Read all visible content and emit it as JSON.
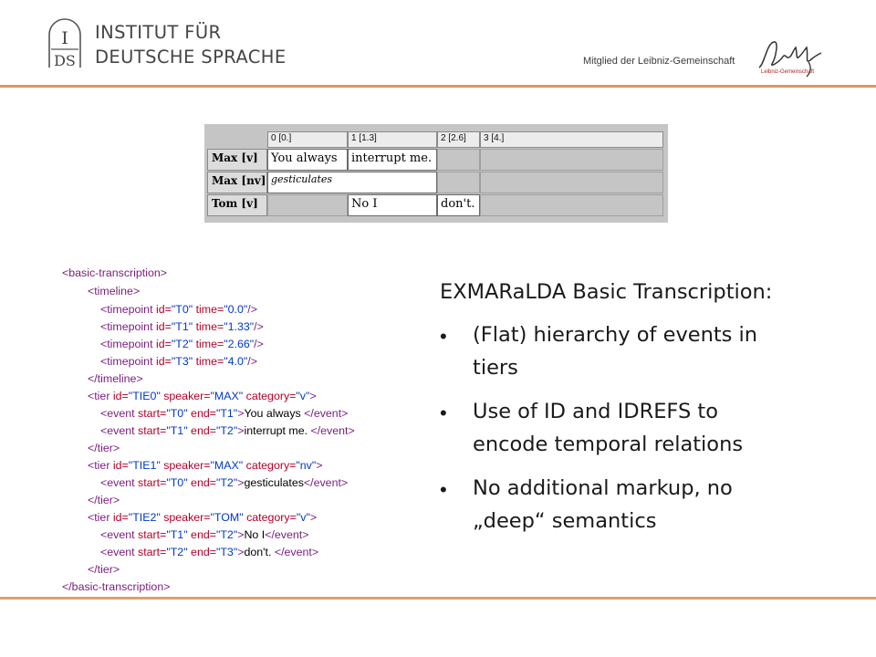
{
  "header": {
    "institute_line1": "INSTITUT FÜR",
    "institute_line2": "DEUTSCHE SPRACHE",
    "member_text": "Mitglied der Leibniz-Gemeinschaft",
    "logo_left": "IDS-logo",
    "logo_right": "Leibniz-Gemeinschaft-logo"
  },
  "score": {
    "columns": [
      "0 [0.]",
      "1 [1.3]",
      "2 [2.6]",
      "3 [4.]"
    ],
    "rows": [
      {
        "label": "Max [v]",
        "events": [
          "You always",
          "interrupt me."
        ]
      },
      {
        "label": "Max [nv]",
        "events": [
          "gesticulates"
        ]
      },
      {
        "label": "Tom [v]",
        "events": [
          "No I",
          "don't."
        ]
      }
    ]
  },
  "xml": {
    "l1": "<basic-transcription>",
    "l2": "<timeline>",
    "l3": {
      "open": "<timepoint ",
      "a1": "id=",
      "v1": "\"T0\"",
      "a2": " time=",
      "v2": "\"0.0\"",
      "close": "/>"
    },
    "l4": {
      "open": "<timepoint ",
      "a1": "id=",
      "v1": "\"T1\"",
      "a2": " time=",
      "v2": "\"1.33\"",
      "close": "/>"
    },
    "l5": {
      "open": "<timepoint ",
      "a1": "id=",
      "v1": "\"T2\"",
      "a2": " time=",
      "v2": "\"2.66\"",
      "close": "/>"
    },
    "l6": {
      "open": "<timepoint ",
      "a1": "id=",
      "v1": "\"T3\"",
      "a2": " time=",
      "v2": "\"4.0\"",
      "close": "/>"
    },
    "l7": "</timeline>",
    "l8": {
      "open": "<tier ",
      "a1": "id=",
      "v1": "\"TIE0\"",
      "a2": " speaker=",
      "v2": "\"MAX\"",
      "a3": " category=",
      "v3": "\"v\"",
      "close": ">"
    },
    "l9": {
      "open": "<event ",
      "a1": "start=",
      "v1": "\"T0\"",
      "a2": " end=",
      "v2": "\"T1\"",
      "mid": ">",
      "text": "You always ",
      "close": "</event>"
    },
    "l10": {
      "open": "<event ",
      "a1": "start=",
      "v1": "\"T1\"",
      "a2": " end=",
      "v2": "\"T2\"",
      "mid": ">",
      "text": "interrupt me. ",
      "close": "</event>"
    },
    "l11": "</tier>",
    "l12": {
      "open": "<tier ",
      "a1": "id=",
      "v1": "\"TIE1\"",
      "a2": " speaker=",
      "v2": "\"MAX\"",
      "a3": " category=",
      "v3": "\"nv\"",
      "close": ">"
    },
    "l13": {
      "open": "<event ",
      "a1": "start=",
      "v1": "\"T0\"",
      "a2": " end=",
      "v2": "\"T2\"",
      "mid": ">",
      "text": "gesticulates",
      "close": "</event>"
    },
    "l14": "</tier>",
    "l15": {
      "open": "<tier ",
      "a1": "id=",
      "v1": "\"TIE2\"",
      "a2": " speaker=",
      "v2": "\"TOM\"",
      "a3": " category=",
      "v3": "\"v\"",
      "close": ">"
    },
    "l16": {
      "open": "<event ",
      "a1": "start=",
      "v1": "\"T1\"",
      "a2": " end=",
      "v2": "\"T2\"",
      "mid": ">",
      "text": "No I",
      "close": "</event>"
    },
    "l17": {
      "open": "<event ",
      "a1": "start=",
      "v1": "\"T2\"",
      "a2": " end=",
      "v2": "\"T3\"",
      "mid": ">",
      "text": "don't. ",
      "close": "</event>"
    },
    "l18": "</tier>",
    "l19": "</basic-transcription>"
  },
  "text": {
    "title": "EXMARaLDA Basic Transcription:",
    "bullet_char": "•",
    "bullets": [
      [
        "(Flat) hierarchy of events in",
        "tiers"
      ],
      [
        "Use of ID and IDREFS to",
        "encode temporal relations"
      ],
      [
        "No additional markup, no",
        "„deep“ semantics"
      ]
    ]
  },
  "colors": {
    "rule": "#d89a62",
    "xml_tag": "#7a1b7f",
    "xml_attr": "#b3002a",
    "xml_value": "#0038c8"
  }
}
